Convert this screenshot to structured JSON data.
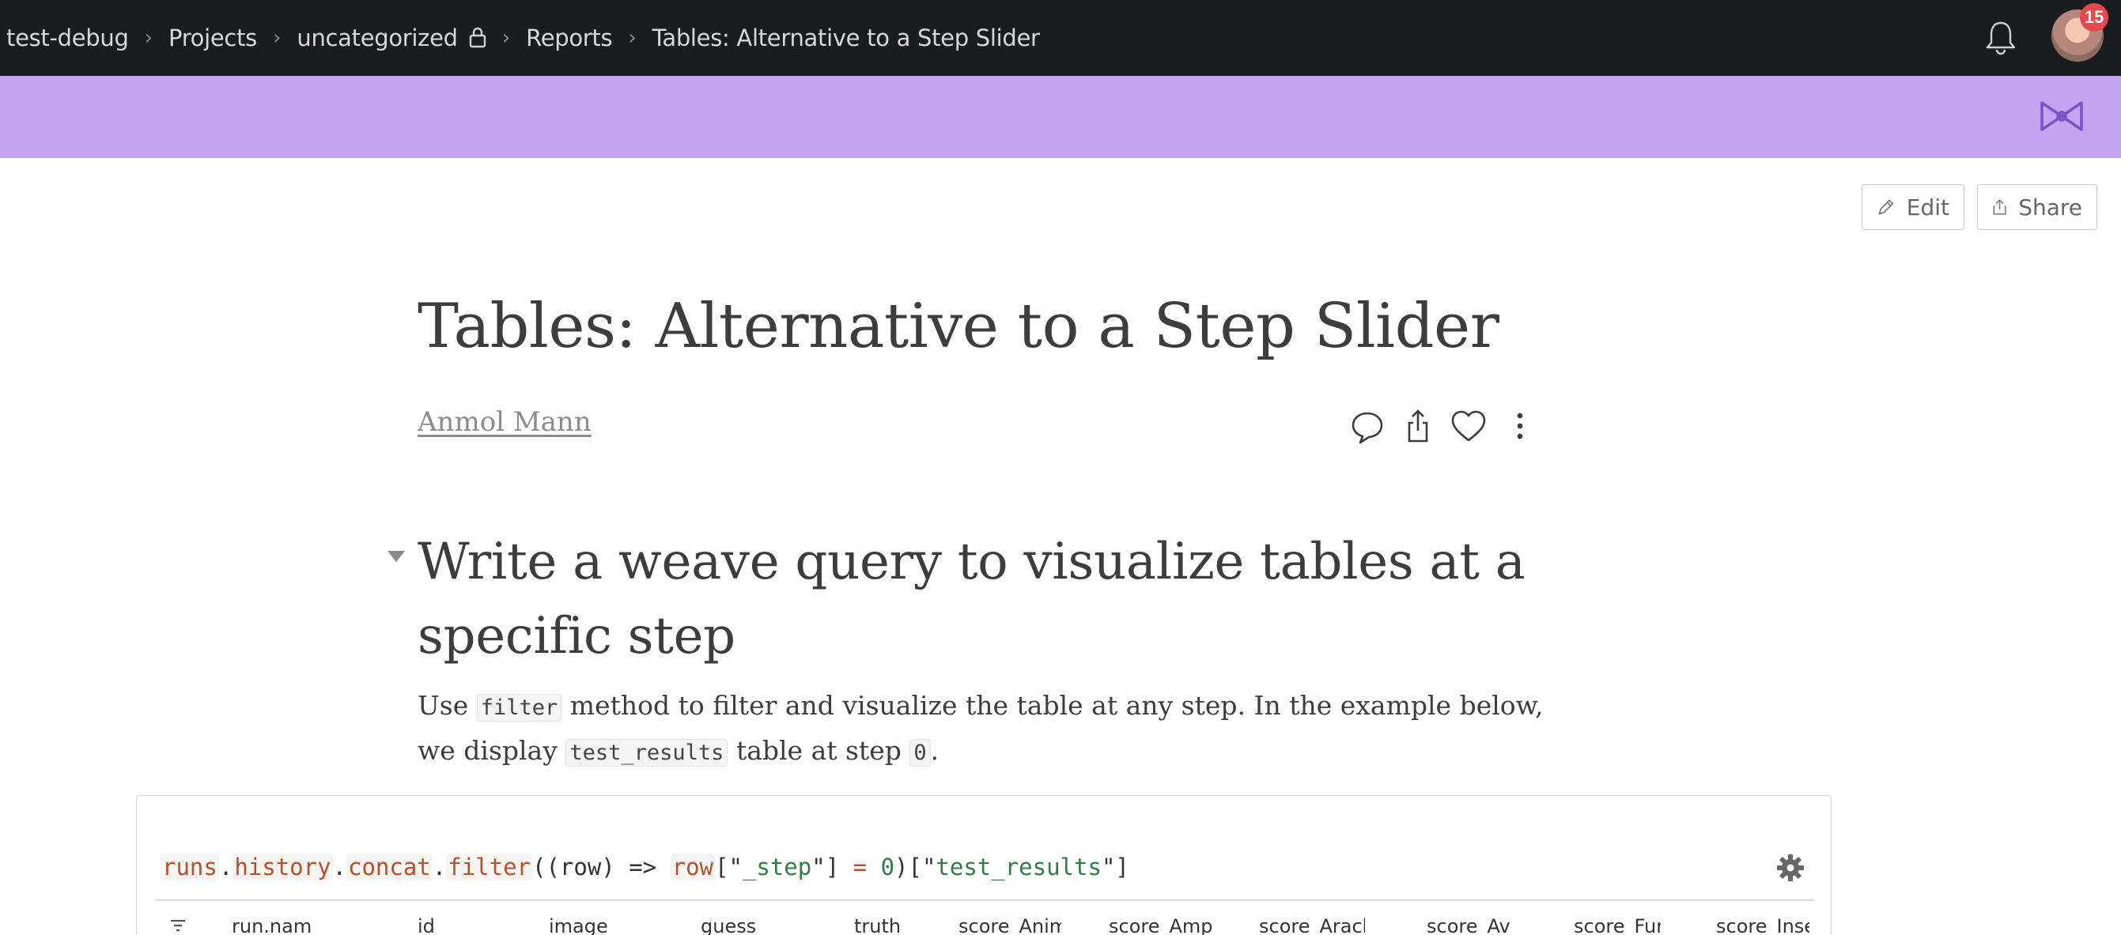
{
  "nav": {
    "breadcrumbs": [
      {
        "label": "test-debug"
      },
      {
        "label": "Projects"
      },
      {
        "label": "uncategorized"
      },
      {
        "label": "Reports"
      },
      {
        "label": "Tables: Alternative to a Step Slider"
      }
    ],
    "notification_count": "15",
    "icons": {
      "bell": "bell-icon",
      "lock": "lock-icon",
      "avatar": "user-avatar"
    }
  },
  "banner": {
    "color": "#c5a5f2",
    "icon": "bowtie-logo-icon"
  },
  "actions": {
    "edit_label": "Edit",
    "share_label": "Share"
  },
  "report": {
    "title": "Tables: Alternative to a Step Slider",
    "author": "Anmol Mann",
    "icons": [
      "comment-icon",
      "share-icon",
      "heart-icon",
      "more-vertical-icon"
    ]
  },
  "section": {
    "heading": "Write a weave query to visualize tables at a specific step",
    "para": {
      "t1": "Use ",
      "c1": "filter",
      "t2": " method to filter and visualize the table at any step. In the example below, we display ",
      "c2": "test_results",
      "t3": " table at step ",
      "c3": "0",
      "t4": "."
    }
  },
  "query": {
    "runs": "runs",
    "history": "history",
    "concat": "concat",
    "filter": "filter",
    "p1": "((row) => ",
    "row": "row",
    "b1": "[\"",
    "step": "_step",
    "b2": "\"] ",
    "eq": "=",
    "sp": " ",
    "zero": "0",
    "b3": ")[\"",
    "test_results": "test_results",
    "b4": "\"]",
    "dot": "."
  },
  "table": {
    "columns": [
      "run.nam",
      "id",
      "image",
      "guess",
      "truth",
      "score_Anim",
      "score_Ampl",
      "score_Arach",
      "score_Ave",
      "score_Fun",
      "score_Inse"
    ]
  },
  "colors": {
    "topnav": "#1a1c1f",
    "accent": "#c5a5f2",
    "badge": "#e5484d"
  }
}
